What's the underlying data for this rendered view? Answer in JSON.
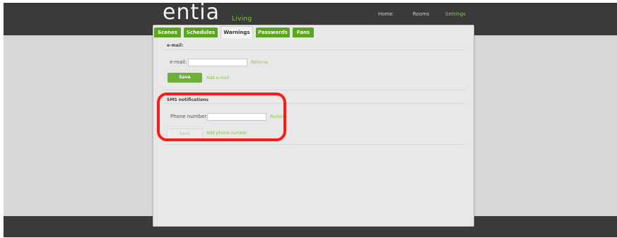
{
  "brand": {
    "name": "entia",
    "sub": "Living"
  },
  "nav": {
    "home": "Home",
    "rooms": "Rooms",
    "settings": "Settings"
  },
  "tabs": [
    "Scenes",
    "Schedules",
    "Warnings",
    "Passwords",
    "Fans"
  ],
  "active_tab": "Warnings",
  "email": {
    "title": "e-mail:",
    "label": "e-mail:",
    "value": "",
    "remove": "Remove",
    "save": "Save",
    "add": "Add e-mail"
  },
  "sms": {
    "title": "SMS notifications",
    "label": "Phone number:",
    "value": "",
    "remove": "Remove",
    "save": "Save",
    "add": "Add phone number"
  },
  "colors": {
    "accent": "#8cc63f",
    "tab": "#5aa61f",
    "highlight": "#ff1a1a"
  }
}
